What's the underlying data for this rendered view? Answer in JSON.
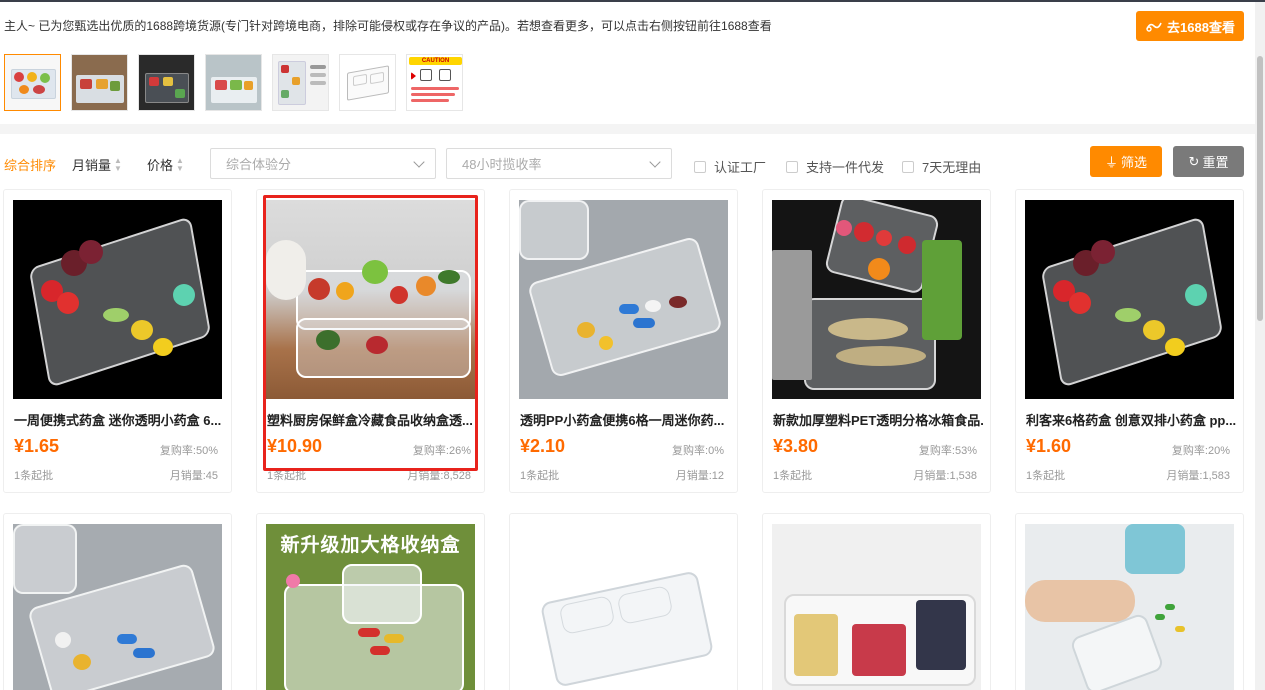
{
  "notice": {
    "text": "主人~ 已为您甄选出优质的1688跨境货源(专门针对跨境电商，排除可能侵权或存在争议的产品)。若想查看更多，可以点击右侧按钮前往1688查看",
    "button_label": "去1688查看"
  },
  "thumbnails": [
    {
      "name": "thumb-1"
    },
    {
      "name": "thumb-2"
    },
    {
      "name": "thumb-3"
    },
    {
      "name": "thumb-4"
    },
    {
      "name": "thumb-5"
    },
    {
      "name": "thumb-6"
    },
    {
      "name": "thumb-7"
    }
  ],
  "thumb_caution": "CAUTION",
  "filters": {
    "sort_comprehensive": "综合排序",
    "sort_monthly_sales": "月销量",
    "sort_price": "价格",
    "select_score_placeholder": "综合体验分",
    "select_rate_placeholder": "48小时揽收率",
    "check_factory": "认证工厂",
    "check_dropship": "支持一件代发",
    "check_return": "7天无理由",
    "filter_button": "筛选",
    "reset_button": "重置"
  },
  "products": [
    {
      "title": "一周便携式药盒 迷你透明小药盒 6...",
      "price": "¥1.65",
      "repurchase": "复购率:50%",
      "moq": "1条起批",
      "sales": "月销量:45"
    },
    {
      "title": "塑料厨房保鲜盒冷藏食品收纳盒透...",
      "price": "¥10.90",
      "repurchase": "复购率:26%",
      "moq": "1条起批",
      "sales": "月销量:8,528"
    },
    {
      "title": "透明PP小药盒便携6格一周迷你药...",
      "price": "¥2.10",
      "repurchase": "复购率:0%",
      "moq": "1条起批",
      "sales": "月销量:12"
    },
    {
      "title": "新款加厚塑料PET透明分格冰箱食品...",
      "price": "¥3.80",
      "repurchase": "复购率:53%",
      "moq": "1条起批",
      "sales": "月销量:1,538"
    },
    {
      "title": "利客来6格药盒 创意双排小药盒 pp...",
      "price": "¥1.60",
      "repurchase": "复购率:20%",
      "moq": "1条起批",
      "sales": "月销量:1,583"
    }
  ],
  "banner_text": "新升级加大格收纳盒",
  "colors": {
    "accent": "#ff8a00",
    "price": "#ff6a00",
    "highlight": "#e8231c"
  }
}
